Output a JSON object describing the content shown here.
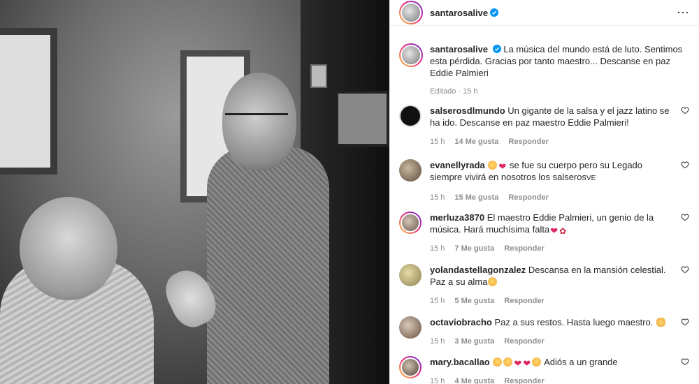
{
  "post": {
    "author": "santarosalive",
    "caption": "La música del mundo está de luto. Sentimos esta pérdida. Gracias por tanto maestro... Descanse en paz Eddie Palmieri",
    "meta": "Editado · 15 h"
  },
  "comments": [
    {
      "user": "salserosdlmundo",
      "text": "Un gigante de la salsa y el jazz latino se ha ido. Descanse en paz maestro Eddie Palmieri!",
      "time": "15 h",
      "likes": "14 Me gusta",
      "reply": "Responder"
    },
    {
      "user": "evanellyrada",
      "pre_emojis": [
        "face",
        "heart"
      ],
      "text": "se fue su cuerpo pero su Legado siempre vivirá en nosotros los salseros",
      "suffix": "VE",
      "time": "15 h",
      "likes": "15 Me gusta",
      "reply": "Responder"
    },
    {
      "user": "merluza3870",
      "text": "El maestro Eddie Palmieri, un genio de la música. Hará muchísima falta",
      "post_emojis": [
        "heart",
        "rose"
      ],
      "time": "15 h",
      "likes": "7 Me gusta",
      "reply": "Responder"
    },
    {
      "user": "yolandastellagonzalez",
      "text": "Descansa en la mansión celestial. Paz a su alma",
      "post_emojis": [
        "face"
      ],
      "time": "15 h",
      "likes": "5 Me gusta",
      "reply": "Responder"
    },
    {
      "user": "octaviobracho",
      "text": "Paz a sus restos. Hasta luego maestro.",
      "post_emojis": [
        "hands"
      ],
      "time": "15 h",
      "likes": "3 Me gusta",
      "reply": "Responder"
    },
    {
      "user": "mary.bacallao",
      "pre_emojis": [
        "face",
        "face",
        "broken-heart",
        "sparkle-heart",
        "face"
      ],
      "text": "Adiós a un grande",
      "time": "15 h",
      "likes": "4 Me gusta",
      "reply": "Responder"
    }
  ],
  "icons": {
    "verified": "verified-badge-icon",
    "more": "more-options-icon",
    "like": "heart-outline-icon"
  },
  "colors": {
    "verified": "#0095f6",
    "text": "#262626",
    "muted": "#8e8e8e"
  }
}
